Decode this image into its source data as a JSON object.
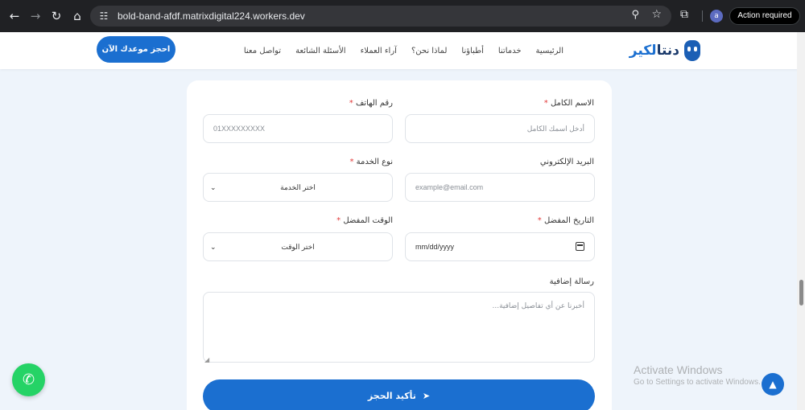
{
  "browser": {
    "url": "bold-band-afdf.matrixdigital224.workers.dev",
    "profile_initial": "a",
    "action_required": "Action required"
  },
  "header": {
    "logo_text_main": "دنتا",
    "logo_text_accent": "لكير",
    "nav": [
      "الرئيسية",
      "خدماتنا",
      "أطباؤنا",
      "لماذا نحن؟",
      "آراء العملاء",
      "الأسئلة الشائعة",
      "تواصل معنا"
    ],
    "cta": "احجز موعدك الآن"
  },
  "form": {
    "full_name_label": "الاسم الكامل",
    "full_name_placeholder": "أدخل اسمك الكامل",
    "phone_label": "رقم الهاتف",
    "phone_placeholder": "01XXXXXXXXX",
    "email_label": "البريد الإلكتروني",
    "email_placeholder": "example@email.com",
    "service_label": "نوع الخدمة",
    "service_selected": "اختر الخدمة",
    "date_label": "التاريخ المفضل",
    "date_value": "mm/dd/yyyy",
    "time_label": "الوقت المفضل",
    "time_selected": "اختر الوقت",
    "message_label": "رسالة إضافية",
    "message_placeholder": "أخبرنا عن أي تفاصيل إضافية...",
    "required_mark": "*",
    "submit": "تأكيد الحجز"
  },
  "overlay": {
    "windows_title": "Activate Windows",
    "windows_sub": "Go to Settings to activate Windows."
  },
  "colors": {
    "primary": "#1b6fd0",
    "whatsapp": "#25d366",
    "background": "#eef4fb"
  }
}
